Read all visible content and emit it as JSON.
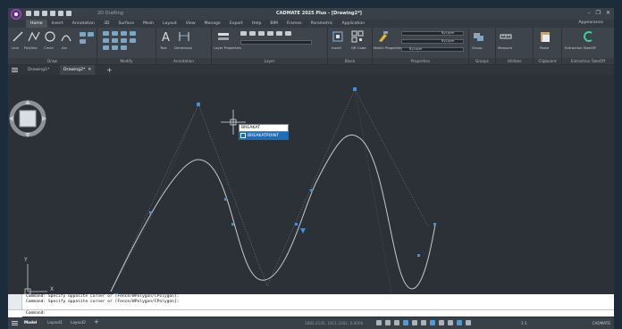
{
  "titlebar": {
    "workspace": "2D Drafting",
    "title": "CADMATE 2025 Plus - [Drawing2*]"
  },
  "ribbon_tabs": [
    "Home",
    "Insert",
    "Annotation",
    "3D",
    "Surface",
    "Mesh",
    "Layout",
    "View",
    "Manage",
    "Export",
    "Help",
    "BIM",
    "Frames",
    "Parametric",
    "Application"
  ],
  "appearance_label": "Appearance",
  "ribbon": {
    "draw": {
      "title": "Draw",
      "line": "Line",
      "polyline": "Polyline",
      "circle": "Circle",
      "arc": "Arc"
    },
    "modify": {
      "title": "Modify"
    },
    "annotation": {
      "title": "Annotation",
      "text": "Text",
      "dimension": "Dimension"
    },
    "layer": {
      "title": "Layer",
      "properties": "Layer Properties"
    },
    "block": {
      "title": "Block",
      "insert": "Insert",
      "qr": "QR Code"
    },
    "properties": {
      "title": "Properties",
      "match": "Match Properties",
      "bylayer_1": "ByLayer",
      "bylayer_2": "ByLayer",
      "bylayer_3": "ByLayer"
    },
    "groups": {
      "title": "Groups",
      "group": "Group"
    },
    "utilities": {
      "title": "Utilities",
      "measure": "Measure"
    },
    "clipboard": {
      "title": "Clipboard",
      "paste": "Paste"
    },
    "extraction": {
      "title": "Extraction TakeOff",
      "label": "Extraction TakeOff"
    }
  },
  "file_tabs": {
    "tabs": [
      {
        "label": "Drawing1*",
        "active": false
      },
      {
        "label": "Drawing2*",
        "active": true
      }
    ],
    "close": "✕",
    "add": "+"
  },
  "autocomplete": {
    "input_value": "BREAKAT",
    "suggestion": "BREAKATPOINT"
  },
  "ucs": {
    "x": "X",
    "y": "Y"
  },
  "command_history": [
    "Command: Specify opposite corner or [Fence/WPolygon/CPolygon]:",
    "Command: Specify opposite corner or [Fence/WPolygon/CPolygon]:"
  ],
  "command_prompt": "Command:",
  "status_bar": {
    "tabs": [
      "Model",
      "Layout1",
      "Layout2"
    ],
    "add": "+",
    "coordinates": "2882.4145, 1811.3302, 0.0000",
    "scale": "1:1",
    "brand": "CADMATE"
  },
  "colors": {
    "curve": "#bfc6cc",
    "construction": "#8a9096",
    "grip": "#3d8fe0",
    "selection": "#1e6db8"
  }
}
